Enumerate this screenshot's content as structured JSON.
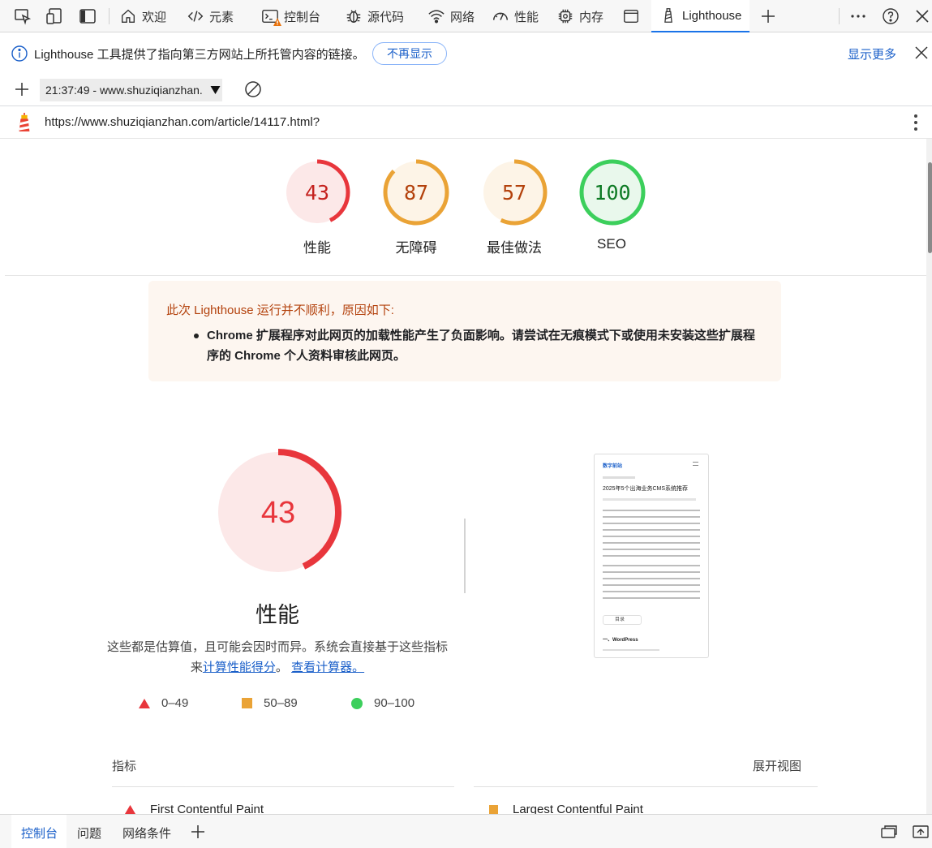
{
  "tabbar": {
    "tabs": [
      {
        "label": "欢迎",
        "icon": "home-icon"
      },
      {
        "label": "元素",
        "icon": "code-icon"
      },
      {
        "label": "控制台",
        "icon": "console-icon"
      },
      {
        "label": "源代码",
        "icon": "bug-icon"
      },
      {
        "label": "网络",
        "icon": "wifi-icon"
      },
      {
        "label": "性能",
        "icon": "speedometer-icon"
      },
      {
        "label": "内存",
        "icon": "chip-icon"
      },
      {
        "label": "",
        "icon": "window-icon"
      },
      {
        "label": "Lighthouse",
        "icon": "lighthouse-icon"
      }
    ],
    "active_tab": "Lighthouse"
  },
  "infobar": {
    "message": "Lighthouse 工具提供了指向第三方网站上所托管内容的链接。",
    "dismiss_label": "不再显示",
    "show_more_label": "显示更多"
  },
  "report_selector": {
    "value": "21:37:49 - www.shuziqianzhan."
  },
  "url": "https://www.shuziqianzhan.com/article/14117.html?",
  "categories": [
    {
      "label": "性能",
      "score": 43,
      "status": "fail"
    },
    {
      "label": "无障碍",
      "score": 87,
      "status": "average"
    },
    {
      "label": "最佳做法",
      "score": 57,
      "status": "average"
    },
    {
      "label": "SEO",
      "score": 100,
      "status": "pass"
    }
  ],
  "warning": {
    "title": "此次 Lighthouse 运行并不顺利，原因如下:",
    "item": "Chrome 扩展程序对此网页的加载性能产生了负面影响。请尝试在无痕模式下或使用未安装这些扩展程序的 Chrome 个人资料审核此网页。"
  },
  "performance": {
    "score": 43,
    "title": "性能",
    "desc_prefix": "这些都是估算值，且可能会因时而异。系统会直接基于这些指标来",
    "desc_link1": "计算性能得分",
    "desc_mid": "。",
    "desc_link2": "查看计算器。"
  },
  "legend": [
    {
      "range": "0–49",
      "shape": "triangle"
    },
    {
      "range": "50–89",
      "shape": "square"
    },
    {
      "range": "90–100",
      "shape": "circle"
    }
  ],
  "thumbnail": {
    "brand": "数字前站",
    "headline": "2025年5个出海业务CMS系统推荐",
    "toc_label": "目录",
    "section_label": "一、WordPress"
  },
  "metrics": {
    "label": "指标",
    "expand_label": "展开视图",
    "items": [
      {
        "name": "First Contentful Paint",
        "status": "fail"
      },
      {
        "name": "Largest Contentful Paint",
        "status": "average"
      }
    ]
  },
  "bottombar": {
    "tabs": [
      "控制台",
      "问题",
      "网络条件"
    ],
    "active_tab": "控制台"
  },
  "colors": {
    "fail": "#e8363c",
    "average": "#eaa336",
    "pass": "#3ccf5c",
    "link": "#1a5fc9"
  }
}
